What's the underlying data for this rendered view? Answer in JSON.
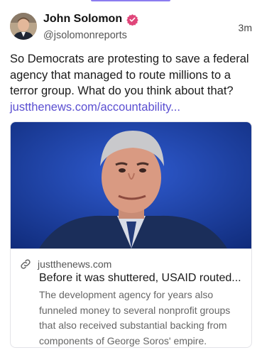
{
  "post": {
    "author": {
      "display_name": "John Solomon",
      "handle": "@jsolomonreports",
      "verified_badge_color": "#e0467a"
    },
    "timestamp": "3m",
    "text": "So Democrats are protesting to save a federal agency that managed to route millions to a terror group. What do you think about that?",
    "link_text": "justthenews.com/accountability...",
    "link_color": "#5b4fd1"
  },
  "link_card": {
    "domain": "justthenews.com",
    "title": "Before it was shuttered, USAID routed...",
    "description": "The development agency for years also funneled money to several nonprofit groups that also received substantial backing from components of George Soros' empire.",
    "icon": "link-icon"
  },
  "icons": {
    "verified": "verified-badge-icon",
    "link": "link-icon"
  }
}
